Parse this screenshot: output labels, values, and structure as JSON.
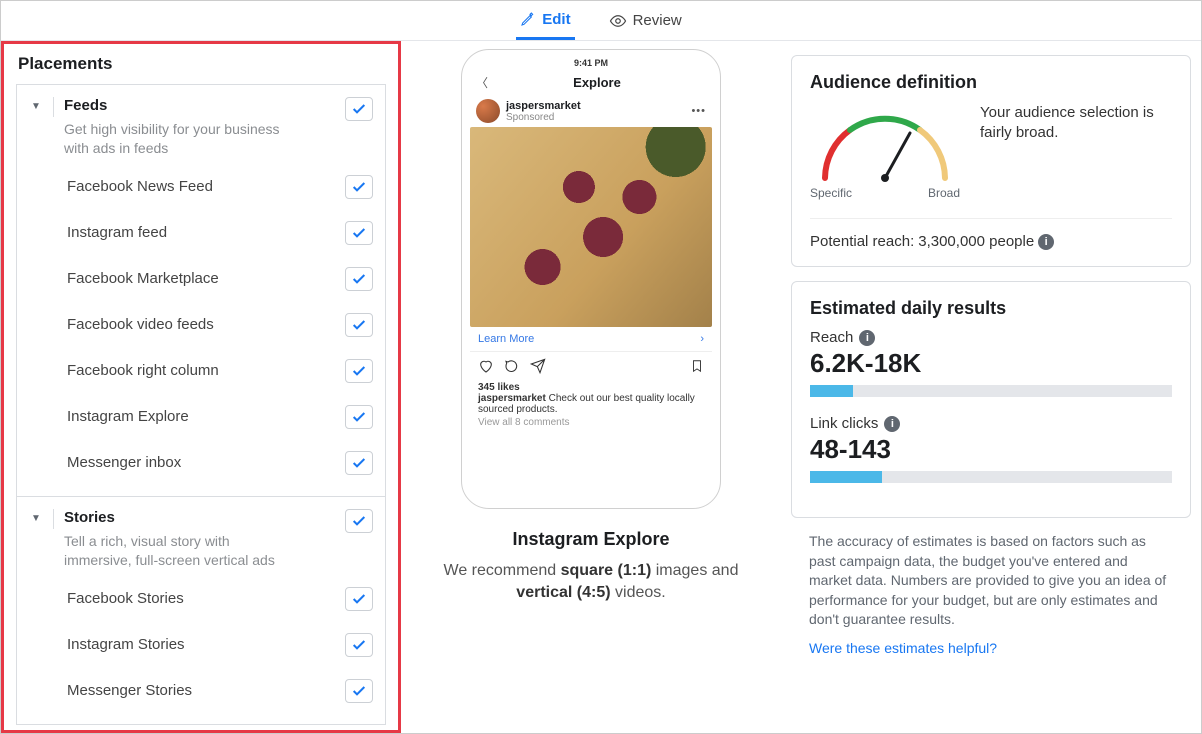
{
  "tabs": {
    "edit": "Edit",
    "review": "Review"
  },
  "placements": {
    "title": "Placements",
    "groups": [
      {
        "name": "Feeds",
        "desc": "Get high visibility for your business with ads in feeds",
        "items": [
          "Facebook News Feed",
          "Instagram feed",
          "Facebook Marketplace",
          "Facebook video feeds",
          "Facebook right column",
          "Instagram Explore",
          "Messenger inbox"
        ]
      },
      {
        "name": "Stories",
        "desc": "Tell a rich, visual story with immersive, full-screen vertical ads",
        "items": [
          "Facebook Stories",
          "Instagram Stories",
          "Messenger Stories"
        ]
      }
    ]
  },
  "preview": {
    "status_time": "9:41 PM",
    "header": "Explore",
    "account": "jaspersmarket",
    "sponsored": "Sponsored",
    "learn_more": "Learn More",
    "likes": "345 likes",
    "caption_user": "jaspersmarket",
    "caption_text": " Check out our best quality locally sourced products.",
    "view_all": "View all 8 comments",
    "title": "Instagram Explore",
    "rec_pre": "We recommend ",
    "rec_b1": "square (1:1)",
    "rec_mid": " images and ",
    "rec_b2": "vertical (4:5)",
    "rec_post": " videos."
  },
  "audience": {
    "title": "Audience definition",
    "summary": "Your audience selection is fairly broad.",
    "label_specific": "Specific",
    "label_broad": "Broad",
    "reach_label": "Potential reach:",
    "reach_value": "3,300,000 people"
  },
  "results": {
    "title": "Estimated daily results",
    "reach_label": "Reach",
    "reach_value": "6.2K-18K",
    "clicks_label": "Link clicks",
    "clicks_value": "48-143",
    "disclaimer": "The accuracy of estimates is based on factors such as past campaign data, the budget you've entered and market data. Numbers are provided to give you an idea of performance for your budget, but are only estimates and don't guarantee results.",
    "feedback": "Were these estimates helpful?"
  }
}
